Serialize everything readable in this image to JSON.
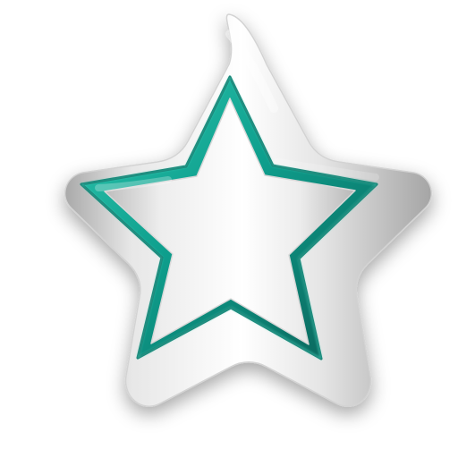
{
  "icon": {
    "name": "star-icon",
    "description_visible_text": "",
    "colors": {
      "background": "#ffffff",
      "silver_light": "#f7f7f7",
      "silver_mid": "#d9d9d9",
      "silver_dark": "#9a9a9a",
      "teal_light": "#2fc7b0",
      "teal_mid": "#0e9f8d",
      "teal_dark": "#0a5f56"
    }
  }
}
